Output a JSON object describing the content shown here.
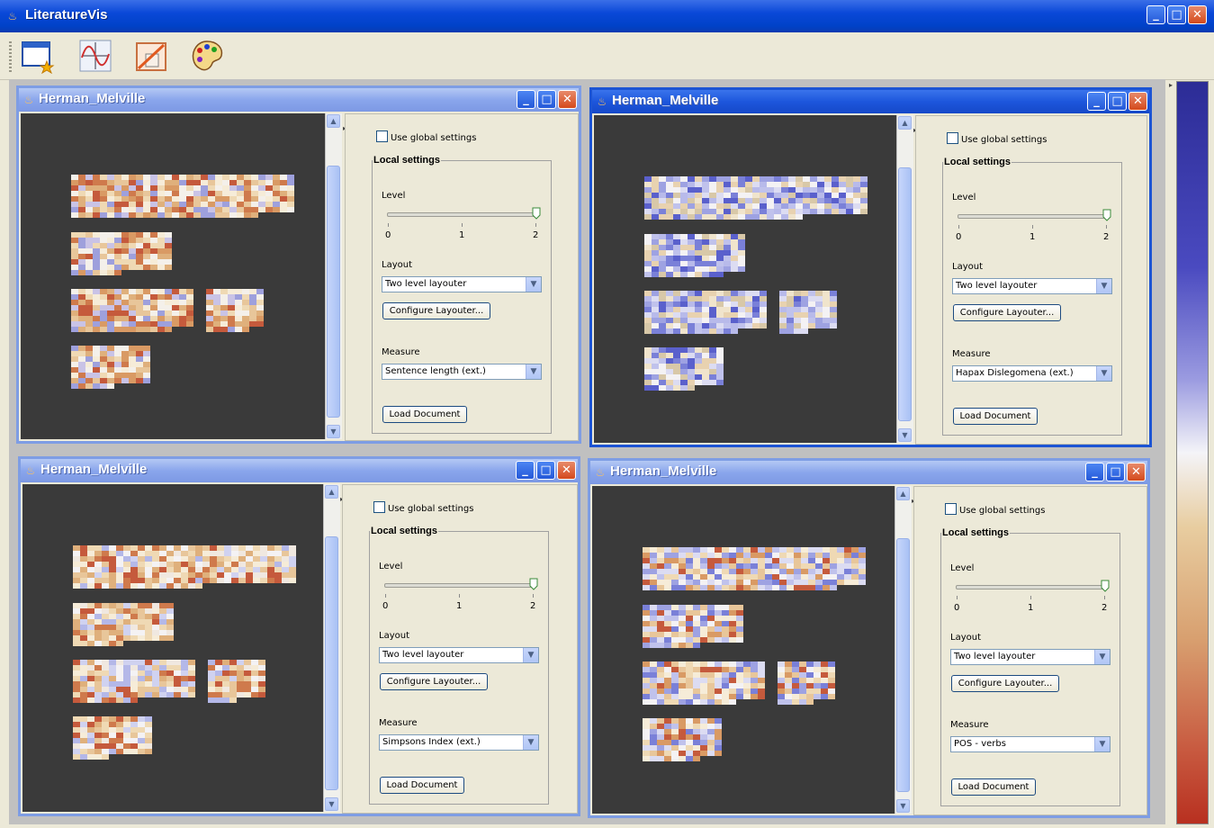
{
  "app": {
    "title": "LiteratureVis"
  },
  "toolbar": {
    "tools": [
      "new-window-icon",
      "plot-icon",
      "layout-icon",
      "palette-icon"
    ]
  },
  "windows": [
    {
      "title": "Herman_Melville",
      "use_global": "Use global settings",
      "local_settings": "Local settings",
      "level_label": "Level",
      "ticks": [
        "0",
        "1",
        "2"
      ],
      "level_value": 2,
      "layout_label": "Layout",
      "layout_value": "Two level layouter",
      "configure_label": "Configure Layouter...",
      "measure_label": "Measure",
      "measure_value": "Sentence length (ext.)",
      "load_label": "Load Document",
      "palette": "warm"
    },
    {
      "title": "Herman_Melville",
      "use_global": "Use global settings",
      "local_settings": "Local settings",
      "level_label": "Level",
      "ticks": [
        "0",
        "1",
        "2"
      ],
      "level_value": 2,
      "layout_label": "Layout",
      "layout_value": "Two level layouter",
      "configure_label": "Configure Layouter...",
      "measure_label": "Measure",
      "measure_value": "Hapax Dislegomena (ext.)",
      "load_label": "Load Document",
      "palette": "cool"
    },
    {
      "title": "Herman_Melville",
      "use_global": "Use global settings",
      "local_settings": "Local settings",
      "level_label": "Level",
      "ticks": [
        "0",
        "1",
        "2"
      ],
      "level_value": 2,
      "layout_label": "Layout",
      "layout_value": "Two level layouter",
      "configure_label": "Configure Layouter...",
      "measure_label": "Measure",
      "measure_value": "Simpsons Index (ext.)",
      "load_label": "Load Document",
      "palette": "mixed"
    },
    {
      "title": "Herman_Melville",
      "use_global": "Use global settings",
      "local_settings": "Local settings",
      "level_label": "Level",
      "ticks": [
        "0",
        "1",
        "2"
      ],
      "level_value": 2,
      "layout_label": "Layout",
      "layout_value": "Two level layouter",
      "configure_label": "Configure Layouter...",
      "measure_label": "Measure",
      "measure_value": "POS - verbs",
      "load_label": "Load Document",
      "palette": "mixed2"
    }
  ],
  "colors": {
    "titlebar": "#0a48d8",
    "canvas": "#3a3a3a",
    "high": "#b83020",
    "low": "#2c2c96",
    "mid": "#f4f4f8"
  }
}
